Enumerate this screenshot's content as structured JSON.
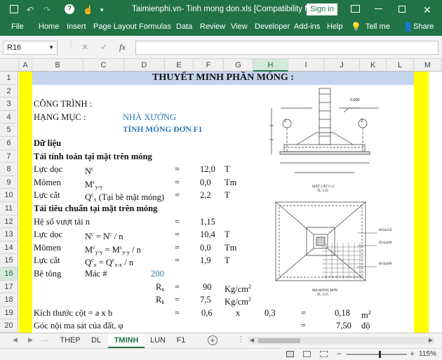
{
  "titlebar": {
    "doc_title": "Taimienphi.vn- Tinh mong don.xls  [Compatibility Mode...",
    "signin": "Sign in",
    "icons": [
      "save-icon",
      "undo-icon",
      "redo-icon",
      "help-icon",
      "touch-mode-icon",
      "customize-qat-icon",
      "ribbon-display-icon",
      "minimize-icon"
    ]
  },
  "ribbon": {
    "tabs": [
      "File",
      "Home",
      "Insert",
      "Page Layout",
      "Formulas",
      "Data",
      "Review",
      "View",
      "Developer",
      "Add-ins",
      "Help"
    ],
    "tell_me": "Tell me",
    "share": "Share"
  },
  "formula_bar": {
    "name_box": "R16",
    "fx": "fx",
    "value": ""
  },
  "columns": [
    "A",
    "B",
    "C",
    "D",
    "E",
    "F",
    "G",
    "H",
    "I",
    "J",
    "K",
    "L",
    "M"
  ],
  "selected_column": "H",
  "rows": [
    "1",
    "2",
    "3",
    "4",
    "5",
    "6",
    "7",
    "8",
    "9",
    "10",
    "11",
    "12",
    "13",
    "14",
    "15",
    "16",
    "17",
    "18",
    "19",
    "20"
  ],
  "selected_row": "16",
  "sheet": {
    "title": "THUYẾT MINH PHẦN MÓNG :",
    "cong_trinh": "CÔNG TRÌNH :",
    "hang_muc": "HẠNG MỤC :",
    "nha_xuong": "NHÀ XƯỞNG",
    "tinh_mong": "TÍNH MÓNG ĐƠN F1",
    "du_lieu": "Dữ liệu",
    "tai_tinh_toan": "Tải tính toán tại mặt trên móng",
    "luc_doc": "Lực dọc",
    "momen": "Mômen",
    "luc_cat": "Lực cắt",
    "tai_tieu_chuan": "Tải tiêu chuẩn tại mặt trên móng",
    "he_so": "Hệ số vượt tải  n",
    "be_tong": "Bê tông",
    "mac": "Mác #",
    "mac_value": "200",
    "kich_thuoc": "Kích thước cột = a x b",
    "goc_noi_ma_sat": "Góc nội ma sát của đất, φ",
    "eq": "=",
    "r8_sym": "N",
    "r8_sup": "c",
    "r8_val": "12,0",
    "r8_unit": "T",
    "r9_sym": "M",
    "r9_sup": "c",
    "r9_sub": "y-y",
    "r9_val": "0,0",
    "r9_unit": "Tm",
    "r10_sym": "Q",
    "r10_sup": "c",
    "r10_sub": "x",
    "r10_note": "(Tại bề mặt móng)",
    "r10_val": "2,2",
    "r10_unit": "T",
    "r12_val": "1,15",
    "r13_lhs": "N",
    "r13_lsup": "c",
    "r13_mid": " = N",
    "r13_rsup": "c",
    "r13_tail": " / n",
    "r13_val": "10,4",
    "r13_unit": "T",
    "r14_lhs": "M",
    "r14_lsup": "c",
    "r14_lsub": "y-y",
    "r14_mid": " = M",
    "r14_rsup": "c",
    "r14_rsub": "y-y",
    "r14_tail": " / n",
    "r14_val": "0,0",
    "r14_unit": "Tm",
    "r15_lhs": "Q",
    "r15_lsup": "c",
    "r15_lsub": "x",
    "r15_mid": " = Q",
    "r15_rsup": "c",
    "r15_rsub": "x-x",
    "r15_tail": " / n",
    "r15_val": "1,9",
    "r15_unit": "T",
    "r17_sym": "R",
    "r17_sub": "n",
    "r17_val": "90",
    "r17_unit": "Kg/cm",
    "r17_unit_sup": "2",
    "r18_sym": "R",
    "r18_sub": "k",
    "r18_val": "7,5",
    "r18_unit": "Kg/cm",
    "r18_unit_sup": "2",
    "r19_a": "0,6",
    "r19_x": "x",
    "r19_b": "0,3",
    "r19_val": "0,18",
    "r19_unit": "m",
    "r19_unit_sup": "2",
    "r20_val": "7,50",
    "r20_unit": "độ"
  },
  "drawing": {
    "elevation_0": "0.000",
    "axis_1": "1",
    "axis_2": "2",
    "section_caption": "MẶT CẮT C-C",
    "section_scale": "TL 1/25",
    "plan_caption": "MB MÓNG ĐƠN",
    "plan_scale": "TL 1/25",
    "rebar_1": "Ø10a150",
    "rebar_2": "Ø14a200",
    "rebar_3": "Ø14a200"
  },
  "sheet_tabs": [
    "THEP",
    "DL",
    "TMINH",
    "LUN",
    "F1"
  ],
  "active_tab": "TMINH",
  "status": {
    "zoom": "115%"
  }
}
